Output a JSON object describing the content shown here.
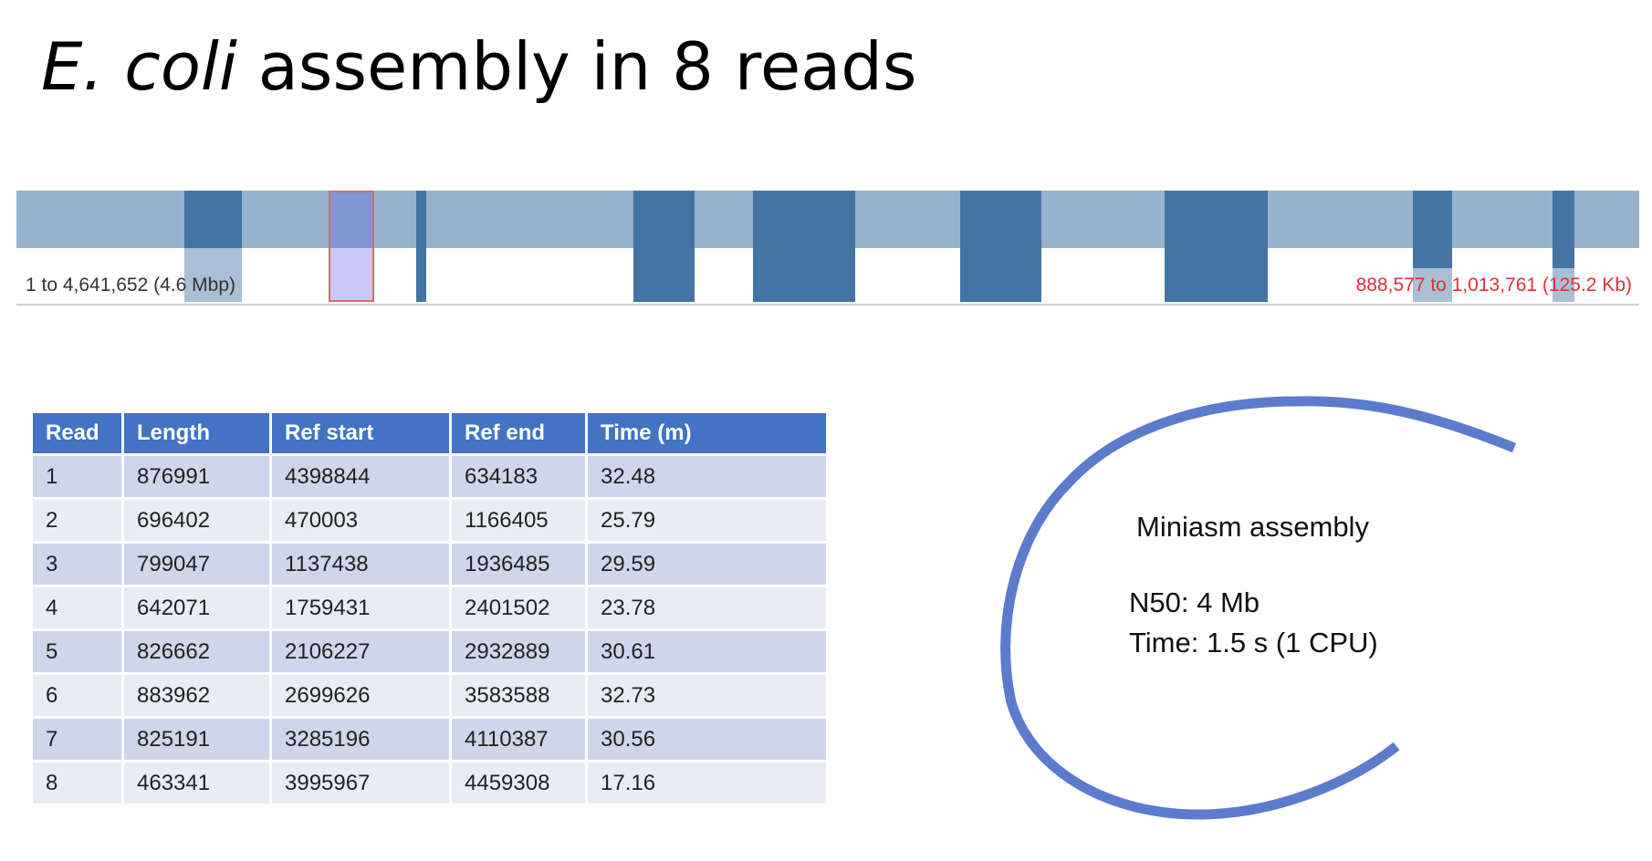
{
  "title": {
    "italic_part": "E. coli",
    "rest": " assembly in 8 reads"
  },
  "track": {
    "range_label": "1 to 4,641,652 (4.6 Mbp)",
    "selection_label": "888,577 to 1,013,761 (125.2 Kb)",
    "colors": {
      "band": "#97b2cc",
      "block": "#4474a3",
      "selection_fill": "#c9c9f6",
      "selection_border": "#d76a6a",
      "label_red": "#e0303a"
    }
  },
  "table": {
    "headers": [
      "Read",
      "Length",
      "Ref start",
      "Ref end",
      "Time (m)"
    ],
    "rows": [
      [
        "1",
        "876991",
        "4398844",
        "634183",
        "32.48"
      ],
      [
        "2",
        "696402",
        "470003",
        "1166405",
        "25.79"
      ],
      [
        "3",
        "799047",
        "1137438",
        "1936485",
        "29.59"
      ],
      [
        "4",
        "642071",
        "1759431",
        "2401502",
        "23.78"
      ],
      [
        "5",
        "826662",
        "2106227",
        "2932889",
        "30.61"
      ],
      [
        "6",
        "883962",
        "2699626",
        "3583588",
        "32.73"
      ],
      [
        "7",
        "825191",
        "3285196",
        "4110387",
        "30.56"
      ],
      [
        "8",
        "463341",
        "3995967",
        "4459308",
        "17.16"
      ]
    ],
    "header_color": "#4472c4"
  },
  "assembly": {
    "title": "Miniasm assembly",
    "n50": "N50: 4 Mb",
    "time": "Time: 1.5 s (1 CPU)",
    "arc_color": "#5b7ccc"
  }
}
